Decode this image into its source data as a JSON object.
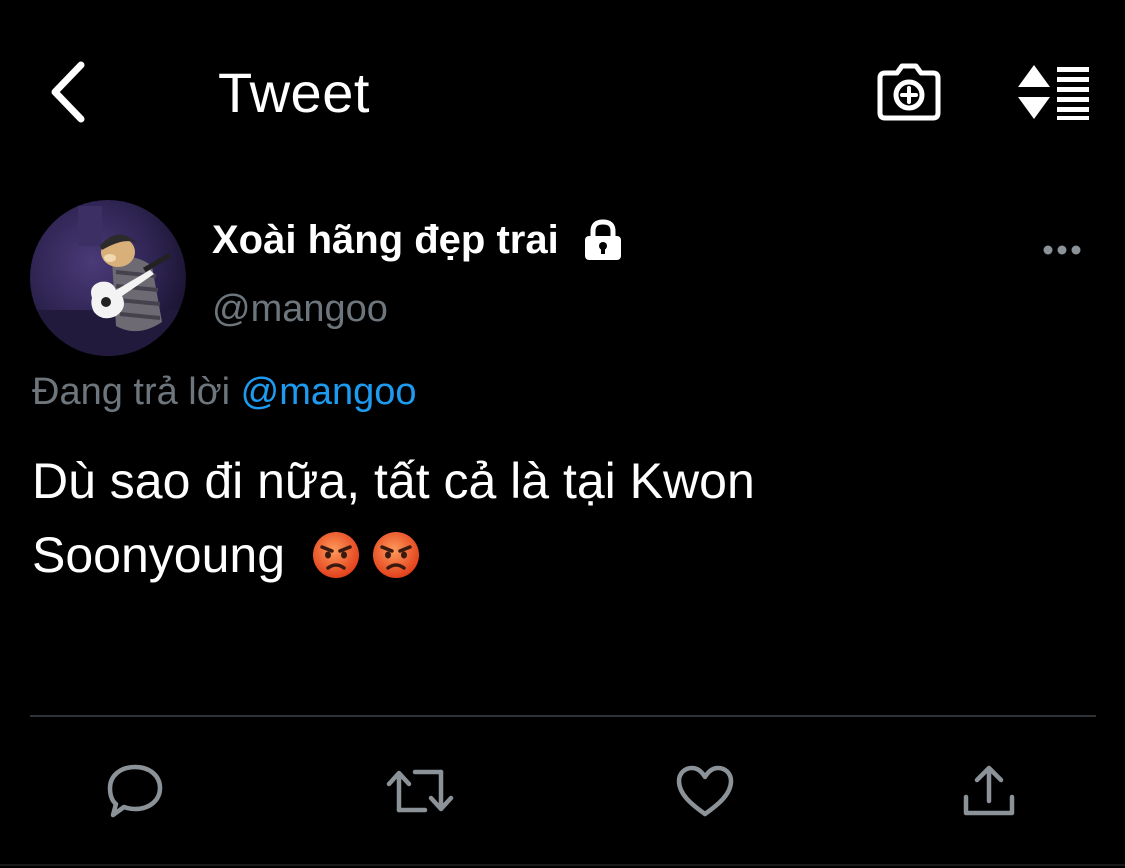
{
  "header": {
    "title": "Tweet",
    "back_icon": "chevron-left-icon",
    "camera_icon": "camera-add-icon",
    "sort_icon": "sort-icon"
  },
  "tweet": {
    "author": {
      "display_name": "Xoài hãng đẹp trai",
      "handle": "@mangoo",
      "protected": true
    },
    "reply_context": {
      "prefix": "Đang trả lời",
      "mention": "@mangoo"
    },
    "text_line1": "Dù sao đi nữa, tất cả là tại Kwon",
    "text_line2": "Soonyoung",
    "emojis": [
      "angry-face",
      "angry-face"
    ]
  },
  "colors": {
    "background": "#000000",
    "text": "#ffffff",
    "secondary": "#6e767d",
    "link": "#1d9bf0",
    "divider": "#2f3336"
  }
}
